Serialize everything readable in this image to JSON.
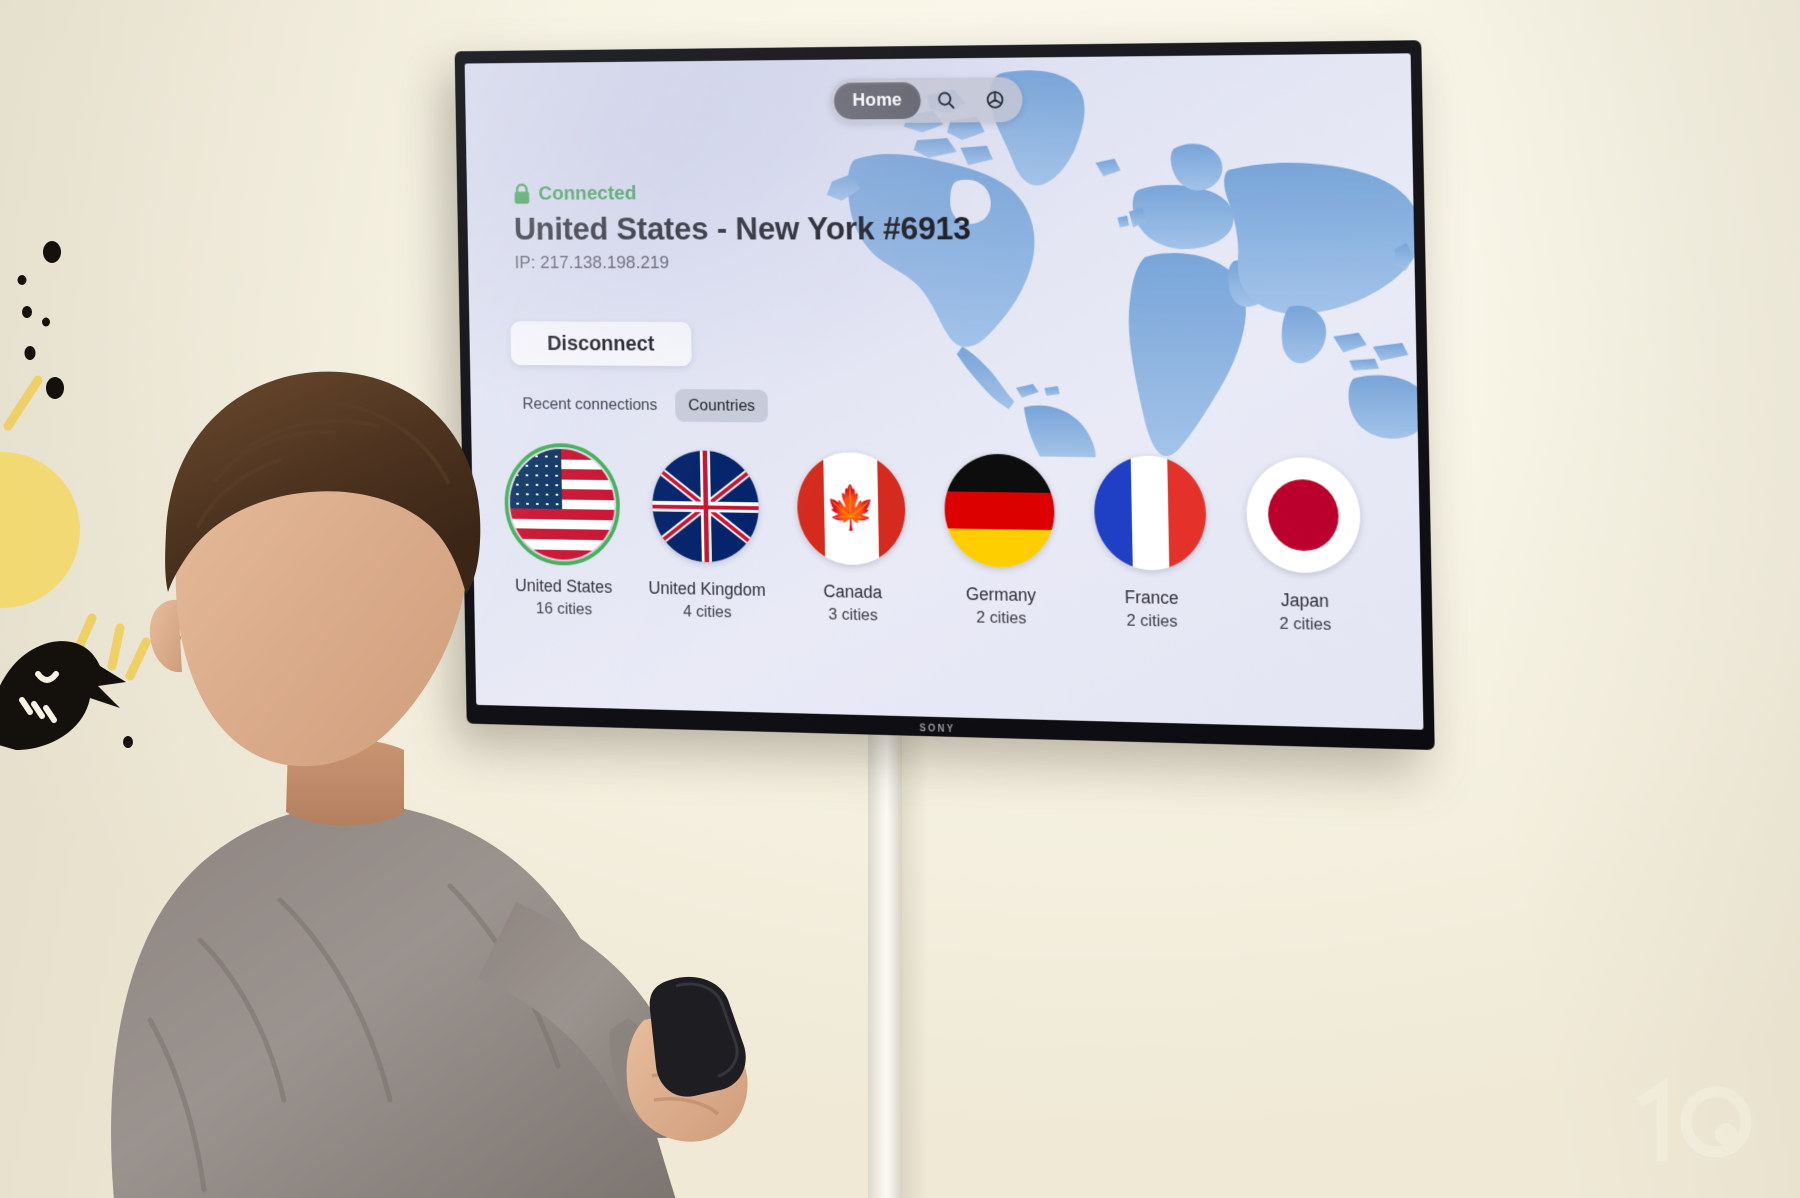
{
  "scene": {
    "tv_brand": "SONY",
    "watermark": "10"
  },
  "app": {
    "nav": {
      "items": [
        {
          "label": "Home",
          "icon": "home-label",
          "active": true
        },
        {
          "label": "",
          "icon": "search-icon",
          "active": false
        },
        {
          "label": "",
          "icon": "settings-icon",
          "active": false
        }
      ]
    },
    "status": {
      "lock_icon": "lock-icon",
      "connection_label": "Connected",
      "connection_color": "#2c9a3f",
      "server_title": "United States - New York #6913",
      "ip_line": "IP: 217.138.198.219"
    },
    "disconnect_label": "Disconnect",
    "tabs": [
      {
        "label": "Recent connections",
        "active": false
      },
      {
        "label": "Countries",
        "active": true
      }
    ],
    "countries": [
      {
        "name": "United States",
        "cities": "16 cities",
        "flag": "us",
        "selected": true
      },
      {
        "name": "United Kingdom",
        "cities": "4 cities",
        "flag": "uk",
        "selected": false
      },
      {
        "name": "Canada",
        "cities": "3 cities",
        "flag": "ca",
        "selected": false
      },
      {
        "name": "Germany",
        "cities": "2 cities",
        "flag": "de",
        "selected": false
      },
      {
        "name": "France",
        "cities": "2 cities",
        "flag": "fr",
        "selected": false
      },
      {
        "name": "Japan",
        "cities": "2 cities",
        "flag": "jp",
        "selected": false
      }
    ],
    "map": {
      "icon": "world-map",
      "color": "#7fa9dc"
    },
    "colors": {
      "accent_green": "#2c9a3f",
      "selection_ring": "#3fae55",
      "map_blue": "#7fa9dc",
      "screen_bg": "#e6e8f5",
      "nav_pill": "#c4c7d4",
      "nav_active": "#5e5e66"
    }
  }
}
